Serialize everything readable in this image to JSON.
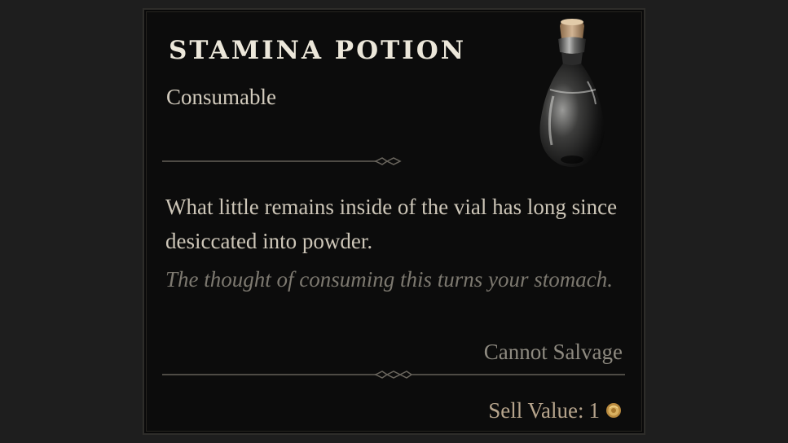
{
  "item": {
    "name": "STAMINA POTION",
    "type": "Consumable",
    "icon": "potion-vial-icon",
    "description": "What little remains inside of the vial has long since desiccated into powder.",
    "flavor_text": "The thought of consuming this turns your stomach.",
    "salvage_text": "Cannot Salvage",
    "sell_label": "Sell Value:",
    "sell_value": "1",
    "currency_icon": "gold-coin-icon"
  },
  "colors": {
    "title": "#ece7da",
    "body_text": "#cdc6b8",
    "flavor_text": "#7d7970",
    "sell_text": "#b6a48c",
    "panel_bg": "#0c0c0c"
  }
}
